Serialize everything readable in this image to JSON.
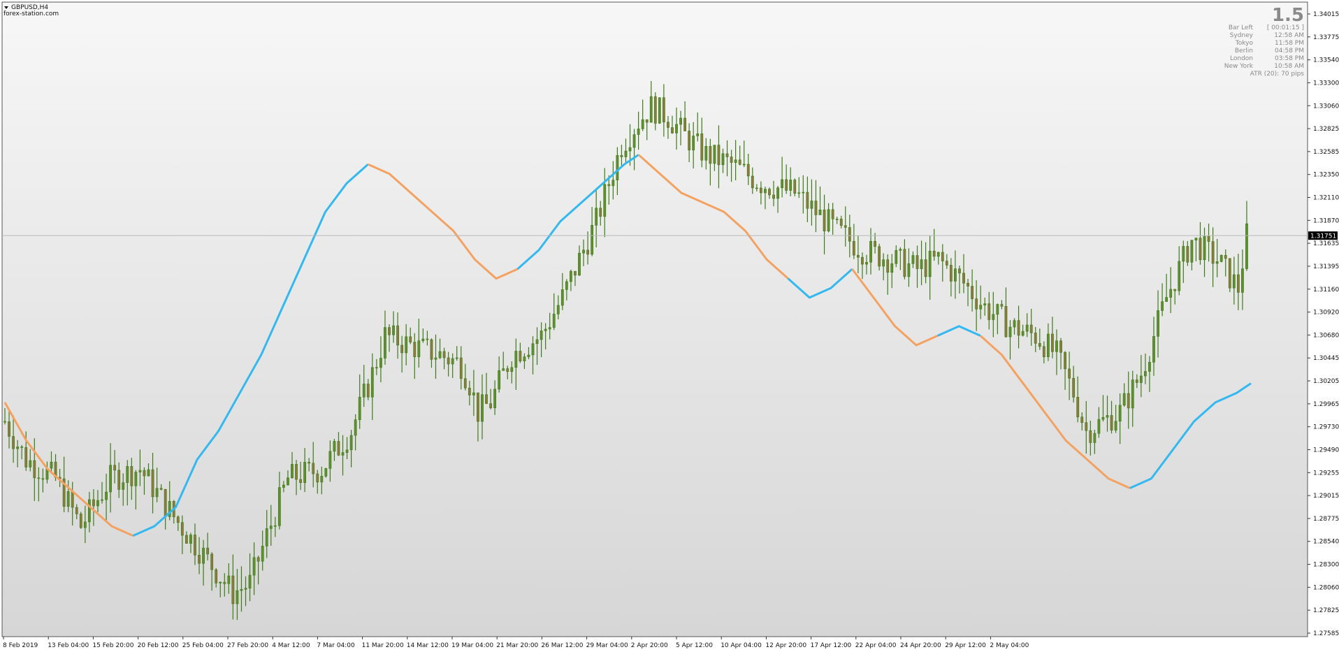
{
  "window": {
    "symbol_title": "GBPUSD,H4",
    "source_label": "forex-station.com",
    "menu_arrow_icon": "triangle-down-icon"
  },
  "info_panel": {
    "big_value": "1.5",
    "rows": [
      {
        "label": "Bar Left",
        "value": "[ 00:01:15 ]"
      },
      {
        "label": "Sydney",
        "value": "12:58 AM"
      },
      {
        "label": "Tokyo",
        "value": "11:58 PM"
      },
      {
        "label": "Berlin",
        "value": "04:58 PM"
      },
      {
        "label": "London",
        "value": "03:58 PM"
      },
      {
        "label": "New York",
        "value": "10:58 AM"
      }
    ],
    "atr_text": "ATR (20): 70 pips"
  },
  "chart_data": {
    "type": "candlestick",
    "symbol": "GBPUSD",
    "timeframe": "H4",
    "ylim": [
      1.27585,
      1.341
    ],
    "y_ticks": [
      "1.34015",
      "1.33775",
      "1.33540",
      "1.33300",
      "1.33060",
      "1.32825",
      "1.32585",
      "1.32350",
      "1.32110",
      "1.31870",
      "1.31635",
      "1.31395",
      "1.31160",
      "1.30920",
      "1.30680",
      "1.30445",
      "1.30205",
      "1.29965",
      "1.29730",
      "1.29490",
      "1.29255",
      "1.29015",
      "1.28775",
      "1.28540",
      "1.28300",
      "1.28060",
      "1.27825",
      "1.27585"
    ],
    "x_tick_labels": [
      "8 Feb 2019",
      "13 Feb 04:00",
      "15 Feb 20:00",
      "20 Feb 12:00",
      "25 Feb 04:00",
      "27 Feb 20:00",
      "4 Mar 12:00",
      "7 Mar 04:00",
      "11 Mar 20:00",
      "14 Mar 12:00",
      "19 Mar 04:00",
      "21 Mar 20:00",
      "26 Mar 12:00",
      "29 Mar 04:00",
      "2 Apr 20:00",
      "5 Apr 12:00",
      "10 Apr 04:00",
      "12 Apr 20:00",
      "17 Apr 12:00",
      "22 Apr 04:00",
      "24 Apr 20:00",
      "29 Apr 12:00",
      "2 May 04:00"
    ],
    "current_price": "1.31751",
    "bar_count": 295,
    "price_path": [
      [
        0,
        1.298
      ],
      [
        5,
        1.294
      ],
      [
        12,
        1.292
      ],
      [
        18,
        1.287
      ],
      [
        25,
        1.292
      ],
      [
        32,
        1.293
      ],
      [
        40,
        1.288
      ],
      [
        47,
        1.284
      ],
      [
        54,
        1.28
      ],
      [
        58,
        1.281
      ],
      [
        62,
        1.286
      ],
      [
        67,
        1.292
      ],
      [
        75,
        1.293
      ],
      [
        82,
        1.297
      ],
      [
        87,
        1.303
      ],
      [
        90,
        1.307
      ],
      [
        96,
        1.306
      ],
      [
        103,
        1.305
      ],
      [
        108,
        1.304
      ],
      [
        110,
        1.302
      ],
      [
        112,
        1.299
      ],
      [
        115,
        1.3
      ],
      [
        120,
        1.305
      ],
      [
        127,
        1.307
      ],
      [
        132,
        1.311
      ],
      [
        136,
        1.315
      ],
      [
        140,
        1.319
      ],
      [
        143,
        1.323
      ],
      [
        146,
        1.327
      ],
      [
        150,
        1.3295
      ],
      [
        153,
        1.331
      ],
      [
        157,
        1.33
      ],
      [
        161,
        1.328
      ],
      [
        166,
        1.326
      ],
      [
        172,
        1.325
      ],
      [
        179,
        1.323
      ],
      [
        187,
        1.322
      ],
      [
        192,
        1.32
      ],
      [
        197,
        1.318
      ],
      [
        203,
        1.316
      ],
      [
        210,
        1.315
      ],
      [
        216,
        1.314
      ],
      [
        221,
        1.315
      ],
      [
        226,
        1.313
      ],
      [
        232,
        1.31
      ],
      [
        238,
        1.308
      ],
      [
        244,
        1.307
      ],
      [
        249,
        1.305
      ],
      [
        253,
        1.301
      ],
      [
        256,
        1.297
      ],
      [
        260,
        1.298
      ],
      [
        264,
        1.299
      ],
      [
        269,
        1.303
      ],
      [
        275,
        1.311
      ],
      [
        281,
        1.317
      ],
      [
        287,
        1.315
      ],
      [
        292,
        1.312
      ],
      [
        294,
        1.3175
      ]
    ],
    "series": [
      {
        "name": "",
        "values": [
          [
            0,
            1.3
          ],
          [
            6,
            1.296
          ],
          [
            12,
            1.293
          ],
          [
            18,
            1.291
          ],
          [
            24,
            1.289
          ],
          [
            30,
            1.287
          ],
          [
            36,
            1.286
          ]
        ],
        "color": "#f4a261"
      },
      {
        "name": "",
        "values": [
          [
            36,
            1.286
          ],
          [
            42,
            1.287
          ],
          [
            48,
            1.289
          ],
          [
            54,
            1.294
          ],
          [
            60,
            1.297
          ],
          [
            66,
            1.301
          ],
          [
            72,
            1.305
          ],
          [
            78,
            1.31
          ],
          [
            84,
            1.315
          ],
          [
            90,
            1.32
          ],
          [
            96,
            1.323
          ],
          [
            102,
            1.325
          ]
        ],
        "color": "#33b8f0"
      },
      {
        "name": "",
        "values": [
          [
            102,
            1.325
          ],
          [
            108,
            1.324
          ],
          [
            114,
            1.322
          ],
          [
            120,
            1.32
          ],
          [
            126,
            1.318
          ],
          [
            132,
            1.315
          ],
          [
            138,
            1.313
          ],
          [
            144,
            1.314
          ]
        ],
        "color": "#f4a261"
      },
      {
        "name": "",
        "values": [
          [
            144,
            1.314
          ],
          [
            150,
            1.316
          ],
          [
            156,
            1.319
          ],
          [
            162,
            1.321
          ],
          [
            168,
            1.323
          ],
          [
            174,
            1.325
          ],
          [
            178,
            1.326
          ]
        ],
        "color": "#33b8f0"
      },
      {
        "name": "",
        "values": [
          [
            178,
            1.326
          ],
          [
            184,
            1.324
          ],
          [
            190,
            1.322
          ],
          [
            196,
            1.321
          ],
          [
            202,
            1.32
          ],
          [
            208,
            1.318
          ],
          [
            214,
            1.315
          ],
          [
            220,
            1.313
          ]
        ],
        "color": "#f4a261"
      },
      {
        "name": "",
        "values": [
          [
            220,
            1.313
          ],
          [
            226,
            1.311
          ],
          [
            232,
            1.312
          ],
          [
            238,
            1.314
          ]
        ],
        "color": "#33b8f0"
      },
      {
        "name": "",
        "values": [
          [
            238,
            1.314
          ],
          [
            244,
            1.311
          ],
          [
            250,
            1.308
          ],
          [
            256,
            1.306
          ],
          [
            262,
            1.307
          ]
        ],
        "color": "#f4a261"
      },
      {
        "name": "",
        "values": [
          [
            262,
            1.307
          ],
          [
            268,
            1.308
          ],
          [
            274,
            1.307
          ]
        ],
        "color": "#33b8f0"
      },
      {
        "name": "",
        "values": [
          [
            274,
            1.307
          ],
          [
            280,
            1.305
          ],
          [
            286,
            1.302
          ],
          [
            292,
            1.299
          ],
          [
            298,
            1.296
          ],
          [
            304,
            1.294
          ],
          [
            310,
            1.292
          ],
          [
            316,
            1.291
          ]
        ],
        "color": "#f4a261"
      },
      {
        "name": "",
        "values": [
          [
            316,
            1.291
          ],
          [
            322,
            1.292
          ],
          [
            328,
            1.295
          ],
          [
            334,
            1.298
          ],
          [
            340,
            1.3
          ],
          [
            346,
            1.301
          ],
          [
            350,
            1.302
          ]
        ],
        "color": "#33b8f0"
      }
    ],
    "horizontal_line": 1.31751
  }
}
